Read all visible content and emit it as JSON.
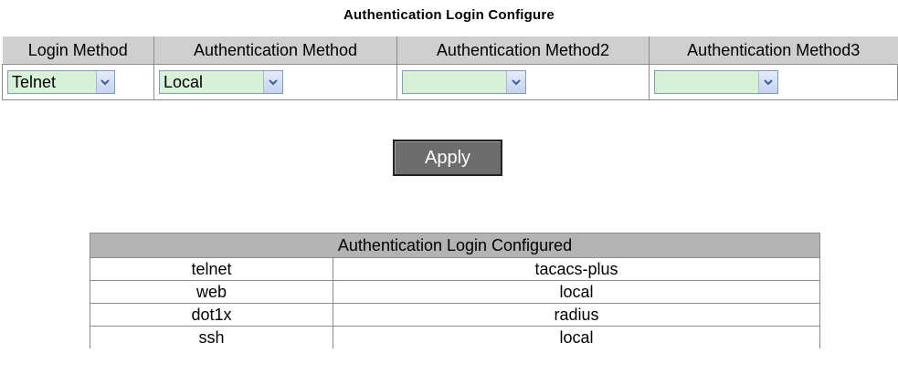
{
  "page_title": "Authentication Login Configure",
  "config_table": {
    "headers": [
      "Login Method",
      "Authentication Method",
      "Authentication Method2",
      "Authentication Method3"
    ],
    "row": {
      "login_method": "Telnet",
      "auth_method1": "Local",
      "auth_method2": "",
      "auth_method3": ""
    }
  },
  "apply_button": "Apply",
  "configured_table": {
    "title": "Authentication Login Configured",
    "rows": [
      {
        "method": "telnet",
        "auth": "tacacs-plus"
      },
      {
        "method": "web",
        "auth": "local"
      },
      {
        "method": "dot1x",
        "auth": "radius"
      },
      {
        "method": "ssh",
        "auth": "local"
      }
    ]
  },
  "colors": {
    "header_bg": "#cfcfcf",
    "configured_header_bg": "#b3b3b3",
    "select_bg": "#d8f0d8",
    "button_bg": "#6d6d6d"
  },
  "icons": {
    "dropdown": "chevron-down-icon"
  }
}
